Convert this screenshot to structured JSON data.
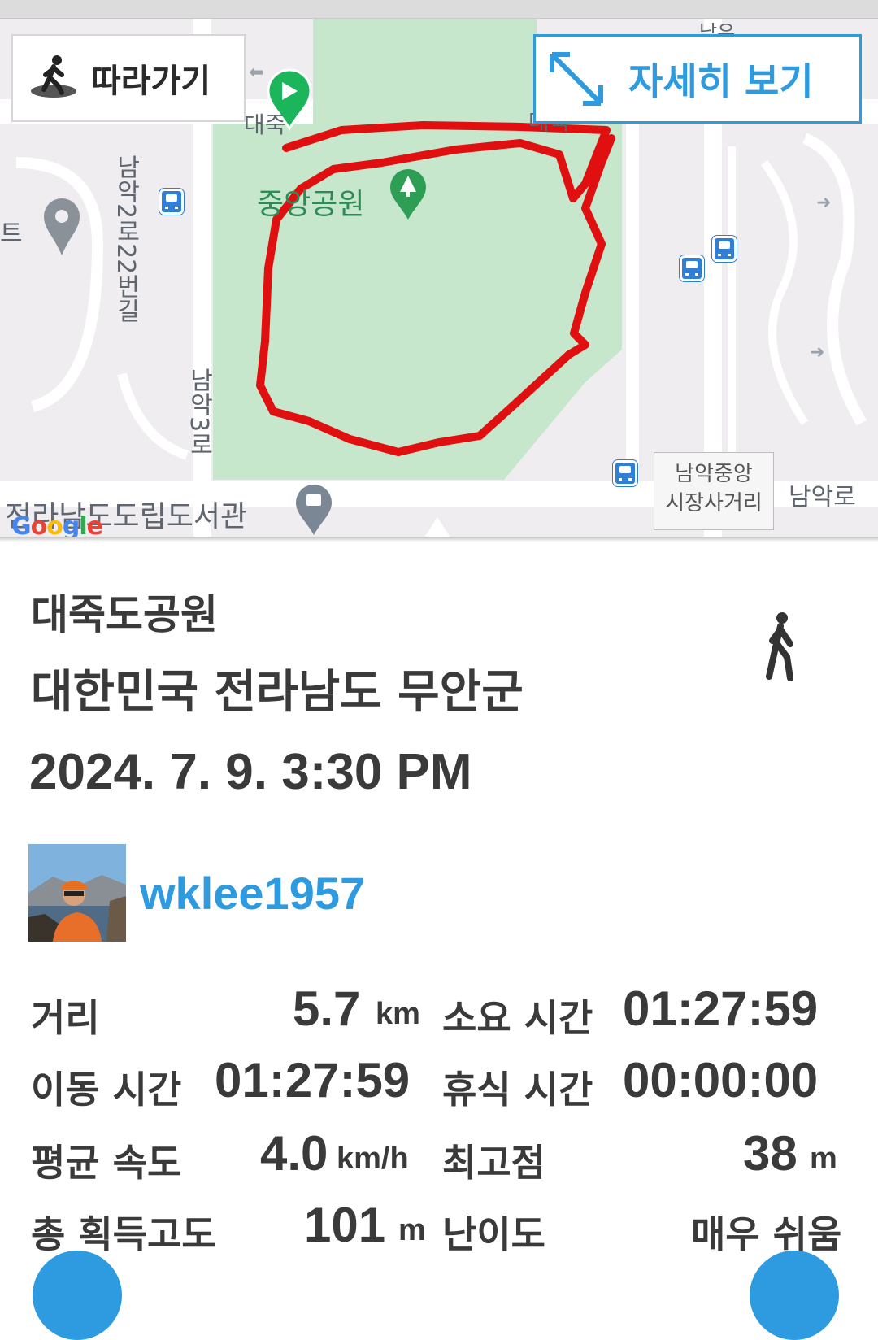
{
  "map": {
    "follow_label": "따라가기",
    "detail_label": "자세히 보기",
    "park_label": "중앙공원",
    "road_label_1": "남악2로22번길",
    "road_label_2": "남악3로",
    "library_label": "전라남도도립도서관",
    "road_label_3": "남악로",
    "intersection_line1": "남악중앙",
    "intersection_line2": "시장사거리",
    "partial_label_left": "트",
    "partial_label_start": "대죽",
    "partial_label_right": "대죽",
    "partial_label_top": "남우",
    "google_logo": "Google",
    "route_color": "#e01010",
    "park_color": "#c7e7cc",
    "start_marker_color": "#1bb55c"
  },
  "info": {
    "place_name": "대죽도공원",
    "region": "대한민국 전라남도 무안군",
    "datetime": "2024. 7. 9. 3:30 PM",
    "activity_icon": "walking-person-icon",
    "username": "wklee1957",
    "accent_color": "#2e9be0"
  },
  "stats": {
    "distance_label": "거리",
    "distance_value": "5.7",
    "distance_unit": "km",
    "duration_label": "소요 시간",
    "duration_value": "01:27:59",
    "moving_time_label": "이동 시간",
    "moving_time_value": "01:27:59",
    "rest_time_label": "휴식 시간",
    "rest_time_value": "00:00:00",
    "avg_speed_label": "평균 속도",
    "avg_speed_value": "4.0",
    "avg_speed_unit": "km/h",
    "max_alt_label": "최고점",
    "max_alt_value": "38",
    "max_alt_unit": "m",
    "gain_label": "총 획득고도",
    "gain_value": "101",
    "gain_unit": "m",
    "difficulty_label": "난이도",
    "difficulty_value": "매우 쉬움"
  }
}
